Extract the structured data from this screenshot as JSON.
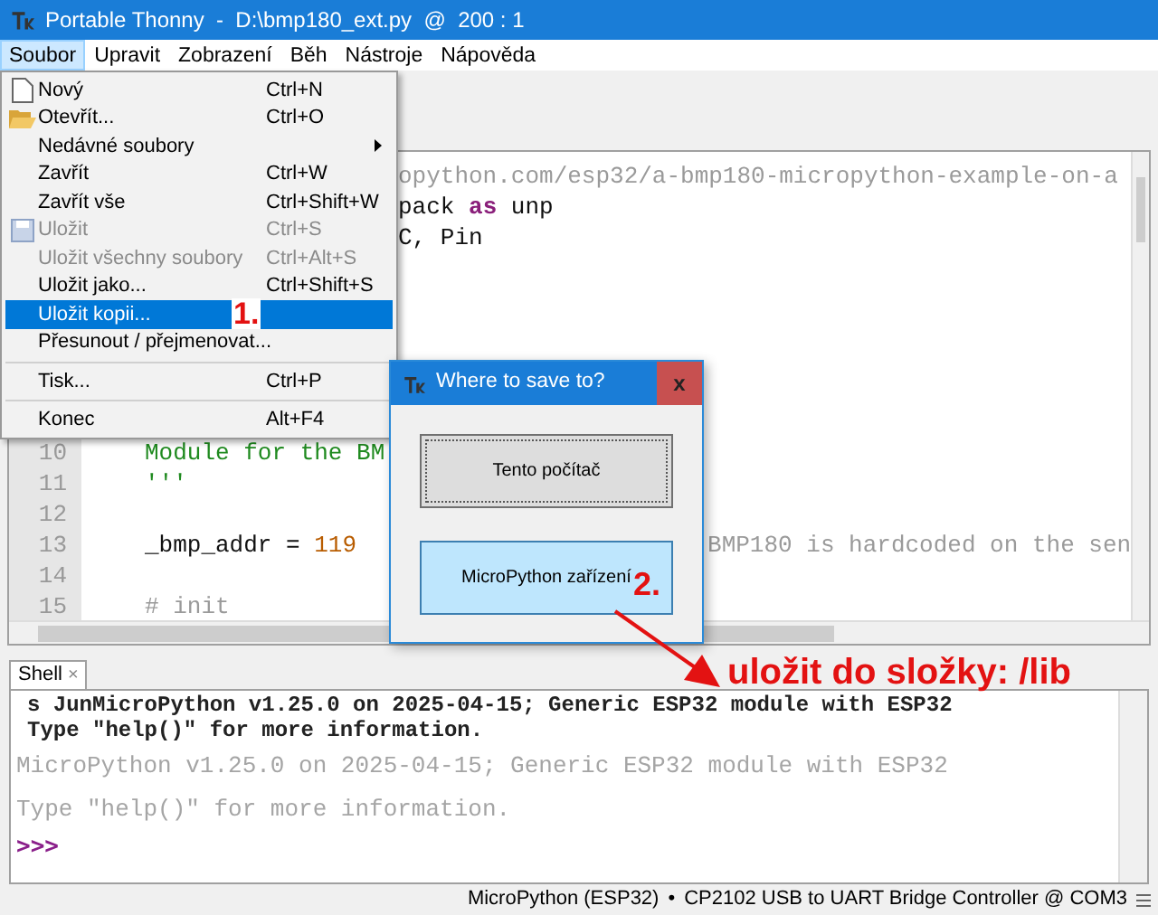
{
  "window": {
    "title": "Portable Thonny  -  D:\\bmp180_ext.py  @  200 : 1"
  },
  "menubar": [
    {
      "label": "Soubor",
      "selected": true
    },
    {
      "label": "Upravit",
      "selected": false
    },
    {
      "label": "Zobrazení",
      "selected": false
    },
    {
      "label": "Běh",
      "selected": false
    },
    {
      "label": "Nástroje",
      "selected": false
    },
    {
      "label": "Nápověda",
      "selected": false
    }
  ],
  "file_menu": [
    {
      "kind": "item",
      "label": "Nový",
      "shortcut": "Ctrl+N",
      "disabled": false,
      "submenu": false,
      "selected": false
    },
    {
      "kind": "item",
      "label": "Otevřít...",
      "shortcut": "Ctrl+O",
      "disabled": false,
      "submenu": false,
      "selected": false
    },
    {
      "kind": "item",
      "label": "Nedávné soubory",
      "disabled": false,
      "submenu": true,
      "selected": false
    },
    {
      "kind": "item",
      "label": "Zavřít",
      "shortcut": "Ctrl+W",
      "disabled": false,
      "submenu": false,
      "selected": false
    },
    {
      "kind": "item",
      "label": "Zavřít vše",
      "shortcut": "Ctrl+Shift+W",
      "disabled": false,
      "submenu": false,
      "selected": false
    },
    {
      "kind": "item",
      "label": "Uložit",
      "shortcut": "Ctrl+S",
      "disabled": true,
      "submenu": false,
      "selected": false
    },
    {
      "kind": "item",
      "label": "Uložit všechny soubory",
      "shortcut": "Ctrl+Alt+S",
      "disabled": true,
      "submenu": false,
      "selected": false
    },
    {
      "kind": "item",
      "label": "Uložit jako...",
      "shortcut": "Ctrl+Shift+S",
      "disabled": false,
      "submenu": false,
      "selected": false
    },
    {
      "kind": "item",
      "label": "Uložit kopii...",
      "disabled": false,
      "submenu": false,
      "selected": true
    },
    {
      "kind": "item",
      "label": "Přesunout / přejmenovat...",
      "disabled": false,
      "submenu": false,
      "selected": false
    },
    {
      "kind": "separator"
    },
    {
      "kind": "item",
      "label": "Tisk...",
      "shortcut": "Ctrl+P",
      "disabled": false,
      "submenu": false,
      "selected": false
    },
    {
      "kind": "separator"
    },
    {
      "kind": "item",
      "label": "Konec",
      "shortcut": "Alt+F4",
      "disabled": false,
      "submenu": false,
      "selected": false
    }
  ],
  "editor": {
    "lines": [
      {
        "parts": [
          {
            "text": "opython.com/esp32/a-bmp180-micropython-example-on-a",
            "kind": "comment"
          }
        ]
      },
      {
        "parts": [
          {
            "text": "pack ",
            "kind": "plain"
          },
          {
            "text": "as",
            "kind": "keyword"
          },
          {
            "text": " unp",
            "kind": "plain"
          }
        ]
      },
      {
        "parts": [
          {
            "text": "C, Pin",
            "kind": "plain"
          }
        ]
      },
      {
        "number": "10",
        "parts": [
          {
            "text": "Module for the BM",
            "kind": "string"
          }
        ]
      },
      {
        "number": "11",
        "parts": [
          {
            "text": "'''",
            "kind": "string"
          }
        ]
      },
      {
        "number": "12"
      },
      {
        "number": "13",
        "parts": [
          {
            "text": "_bmp_addr = ",
            "kind": "plain"
          },
          {
            "text": "119",
            "kind": "number"
          }
        ],
        "tail": {
          "text": "BMP180 is hardcoded on the sen",
          "kind": "comment"
        }
      },
      {
        "number": "14"
      },
      {
        "number": "15",
        "parts": [
          {
            "text": "# init",
            "kind": "comment"
          }
        ]
      }
    ]
  },
  "shell": {
    "tab": "Shell",
    "close": "×",
    "lines": [
      {
        "text": "s JunMicroPython v1.25.0 on 2025-04-15; Generic ESP32 module with ESP32",
        "kind": "output"
      },
      {
        "text": "Type \"help()\" for more information.",
        "kind": "output"
      },
      {
        "text": "MicroPython v1.25.0 on 2025-04-15; Generic ESP32 module with ESP32",
        "kind": "banner"
      },
      {
        "text": "Type \"help()\" for more information.",
        "kind": "banner"
      },
      {
        "text": ">>>",
        "kind": "prompt"
      }
    ]
  },
  "status_bar": {
    "interpreter": "MicroPython (ESP32)",
    "separator": "•",
    "port": "CP2102 USB to UART Bridge Controller @ COM3"
  },
  "dialog": {
    "title": "Where to save to?",
    "close": "x",
    "buttons": [
      {
        "label": "Tento počítač",
        "selected": false
      },
      {
        "label": "MicroPython zařízení",
        "selected": true
      }
    ]
  },
  "annotations": {
    "step1": "1.",
    "step2": "2.",
    "note": "uložit do složky: /lib"
  }
}
